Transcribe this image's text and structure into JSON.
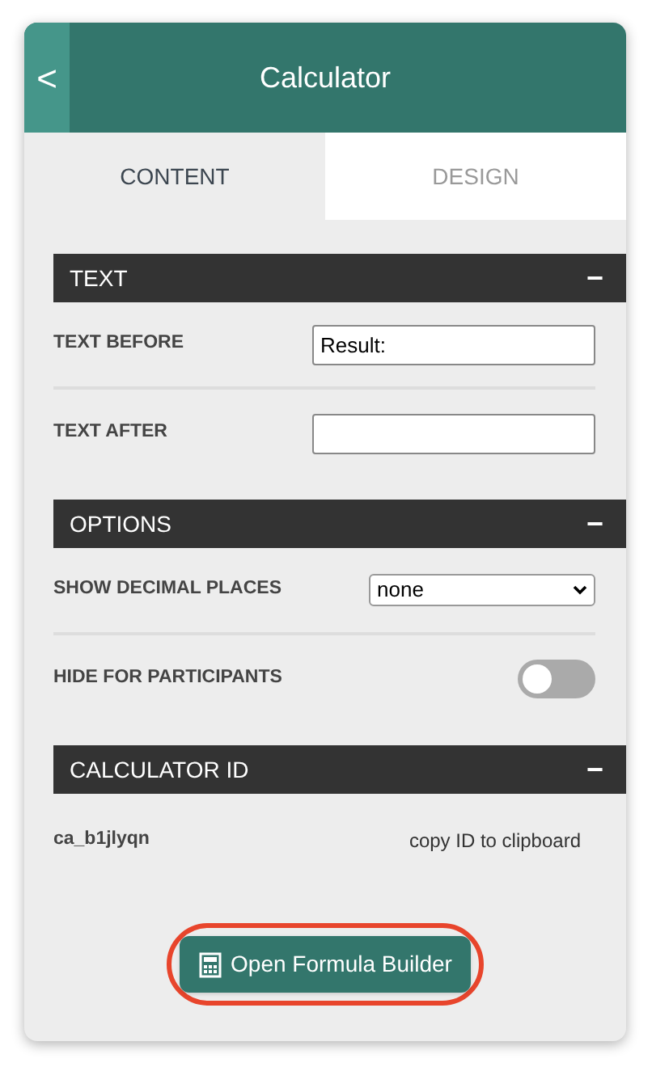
{
  "header": {
    "back": "<",
    "title": "Calculator"
  },
  "tabs": [
    {
      "label": "CONTENT",
      "selected": true
    },
    {
      "label": "DESIGN",
      "selected": false
    }
  ],
  "sections": [
    {
      "title": "TEXT",
      "collapse": "−",
      "rows": [
        {
          "kind": "text_field",
          "label": "TEXT BEFORE",
          "value": "Result:"
        },
        {
          "kind": "text_field",
          "label": "TEXT AFTER"
        }
      ]
    },
    {
      "title": "OPTIONS",
      "collapse": "−",
      "rows": [
        {
          "kind": "select",
          "label": "SHOW DECIMAL PLACES",
          "value": "none"
        },
        {
          "kind": "toggle",
          "label": "HIDE FOR PARTICIPANTS",
          "on": false
        }
      ]
    },
    {
      "title": "CALCULATOR ID",
      "collapse": "−",
      "rows": [
        {
          "kind": "id",
          "label": "ca_b1jlyqn",
          "link": "copy ID to clipboard"
        }
      ]
    }
  ],
  "button": {
    "label": "Open Formula Builder",
    "highlighted": true
  }
}
